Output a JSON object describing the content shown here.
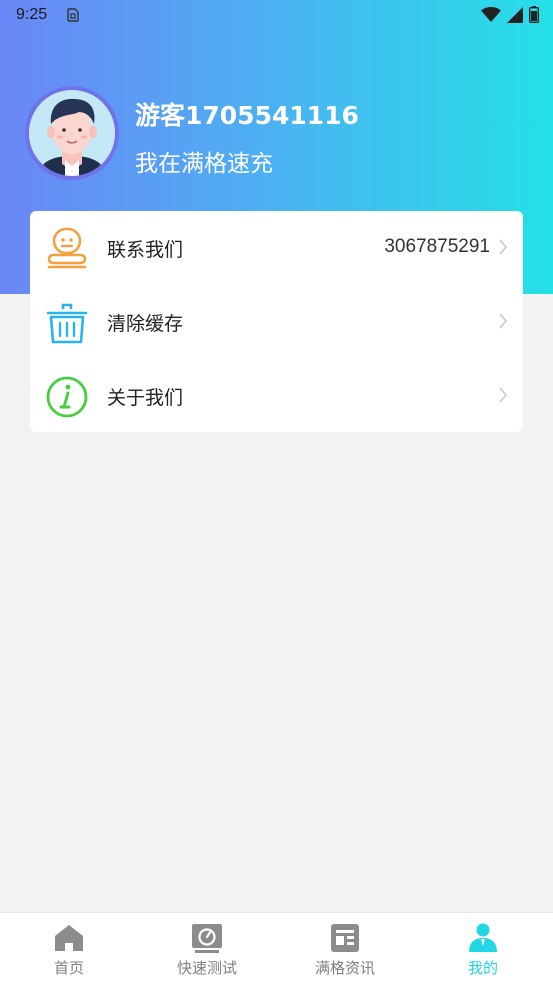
{
  "status_bar": {
    "time": "9:25"
  },
  "profile": {
    "username": "游客1705541116",
    "slogan": "我在满格速充"
  },
  "menu": [
    {
      "label": "联系我们",
      "value": "3067875291",
      "icon": "service-robot-icon"
    },
    {
      "label": "清除缓存",
      "value": "",
      "icon": "trash-basket-icon"
    },
    {
      "label": "关于我们",
      "value": "",
      "icon": "info-icon"
    }
  ],
  "bottom_nav": [
    {
      "label": "首页",
      "icon": "home-icon",
      "active": false
    },
    {
      "label": "快速测试",
      "icon": "speedometer-icon",
      "active": false
    },
    {
      "label": "满格资讯",
      "icon": "news-icon",
      "active": false
    },
    {
      "label": "我的",
      "icon": "person-icon",
      "active": true
    }
  ],
  "colors": {
    "header_gradient_start": "#6a86f6",
    "header_gradient_end": "#24e0e6",
    "active_tab": "#22d6e4",
    "background": "#f2f2f2"
  }
}
